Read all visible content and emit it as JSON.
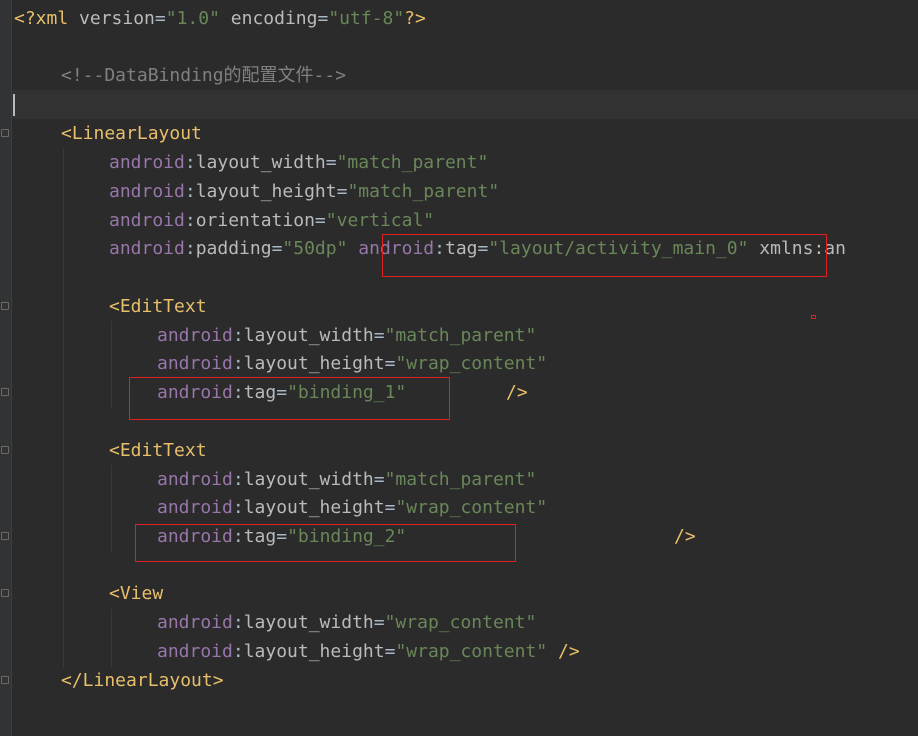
{
  "code": {
    "line1": {
      "open": "<?xml ",
      "a1": "version",
      "eq1": "=",
      "v1": "\"1.0\"",
      "sp": " ",
      "a2": "encoding",
      "eq2": "=",
      "v2": "\"utf-8\"",
      "close": "?>"
    },
    "comment": "<!--DataBinding的配置文件-->",
    "linear_open": "<LinearLayout",
    "ll_attrs": [
      {
        "ns": "android",
        "colon": ":",
        "name": "layout_width",
        "eq": "=",
        "val": "\"match_parent\""
      },
      {
        "ns": "android",
        "colon": ":",
        "name": "layout_height",
        "eq": "=",
        "val": "\"match_parent\""
      },
      {
        "ns": "android",
        "colon": ":",
        "name": "orientation",
        "eq": "=",
        "val": "\"vertical\""
      }
    ],
    "padding_attr": {
      "ns": "android",
      "colon": ":",
      "name": "padding",
      "eq": "=",
      "val": "\"50dp\""
    },
    "ll_tag_attr": {
      "ns": "android",
      "colon": ":",
      "name": "tag",
      "eq": "=",
      "val": "\"layout/activity_main_0\""
    },
    "xmlns_fragment": "xmlns:an",
    "edit1_open": "<EditText",
    "edit1_attrs": [
      {
        "ns": "android",
        "colon": ":",
        "name": "layout_width",
        "eq": "=",
        "val": "\"match_parent\""
      },
      {
        "ns": "android",
        "colon": ":",
        "name": "layout_height",
        "eq": "=",
        "val": "\"wrap_content\""
      }
    ],
    "edit1_tag": {
      "ns": "android",
      "colon": ":",
      "name": "tag",
      "eq": "=",
      "val": "\"binding_1\""
    },
    "edit1_close": "/>",
    "edit2_open": "<EditText",
    "edit2_attrs": [
      {
        "ns": "android",
        "colon": ":",
        "name": "layout_width",
        "eq": "=",
        "val": "\"match_parent\""
      },
      {
        "ns": "android",
        "colon": ":",
        "name": "layout_height",
        "eq": "=",
        "val": "\"wrap_content\""
      }
    ],
    "edit2_tag": {
      "ns": "android",
      "colon": ":",
      "name": "tag",
      "eq": "=",
      "val": "\"binding_2\""
    },
    "edit2_close": "/>",
    "view_open": "<View",
    "view_attrs": [
      {
        "ns": "android",
        "colon": ":",
        "name": "layout_width",
        "eq": "=",
        "val": "\"wrap_content\""
      }
    ],
    "view_last": {
      "ns": "android",
      "colon": ":",
      "name": "layout_height",
      "eq": "=",
      "val": "\"wrap_content\""
    },
    "view_close": " />",
    "linear_close": "</LinearLayout>"
  },
  "colors": {
    "background": "#2b2b2b",
    "tag": "#e8bf6a",
    "namespace": "#9876aa",
    "attribute": "#bababa",
    "value": "#6a8759",
    "comment": "#808080",
    "highlight_box": "#e02020"
  }
}
